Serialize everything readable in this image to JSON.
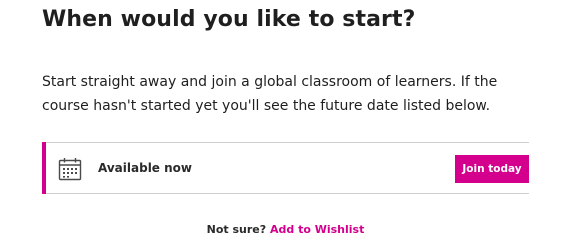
{
  "heading": "When would you like to start?",
  "intro": "Start straight away and join a global classroom of learners. If the course hasn't started yet you'll see the future date listed below.",
  "run": {
    "icon": "calendar-icon",
    "label": "Available now",
    "button_label": "Join today"
  },
  "wishlist": {
    "prompt": "Not sure?",
    "link_label": "Add to Wishlist"
  },
  "colors": {
    "accent": "#d4008d",
    "text": "#1f1f1f",
    "divider": "#cfcfcf"
  }
}
